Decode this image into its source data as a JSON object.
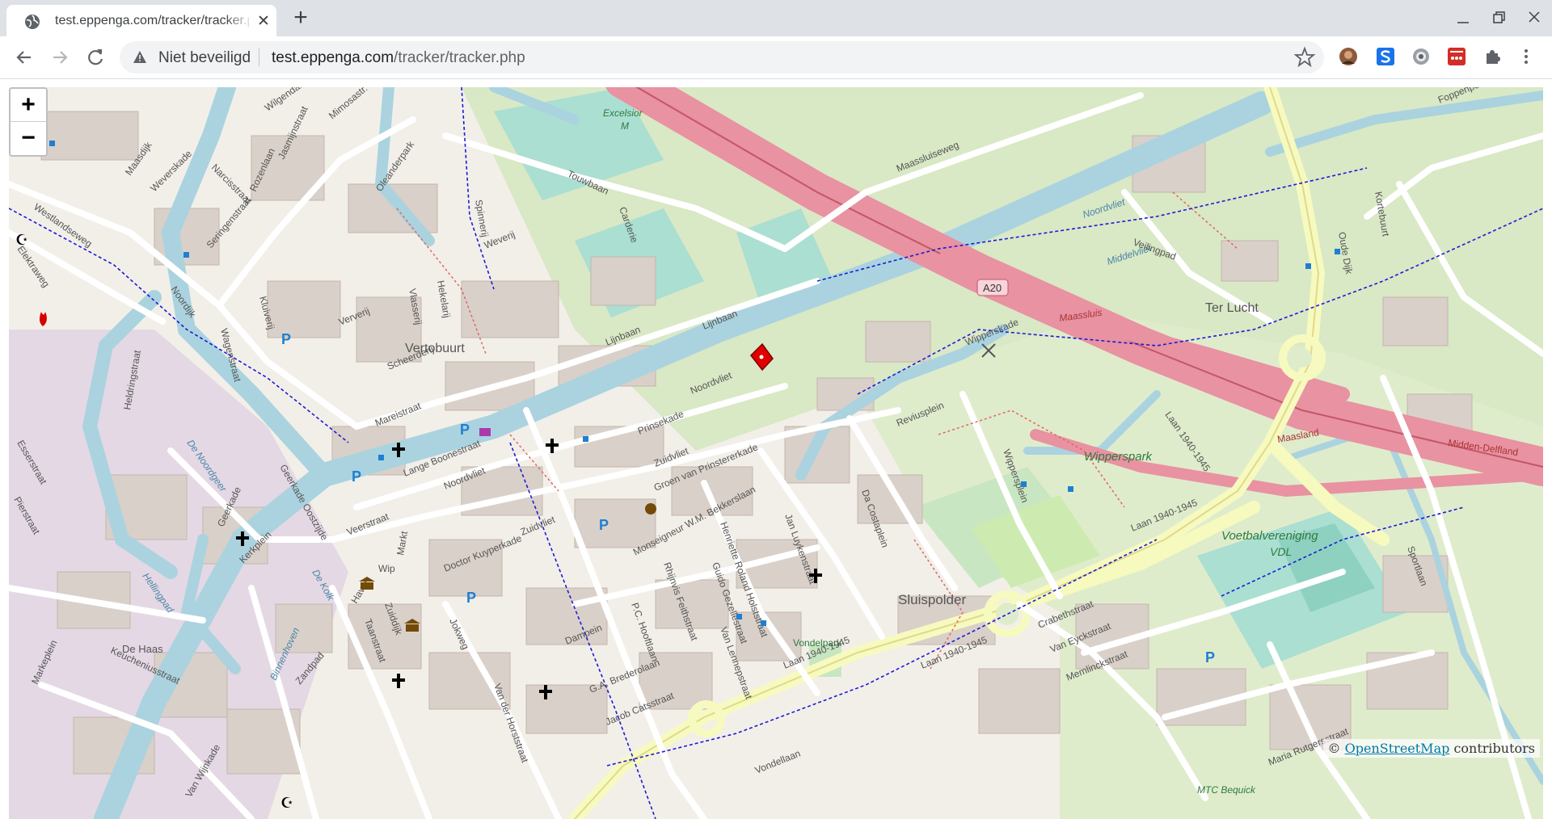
{
  "browser": {
    "tab_title": "test.eppenga.com/tracker/tracker.php",
    "security_label": "Niet beveiligd",
    "url_host": "test.eppenga.com",
    "url_path": "/tracker/tracker.php",
    "icons": [
      "globe-icon",
      "close-icon",
      "plus-icon",
      "minimize-icon",
      "restore-icon",
      "close-window-icon",
      "back-icon",
      "forward-icon",
      "reload-icon",
      "warning-icon",
      "star-icon",
      "puzzle-icon",
      "kebab-menu-icon"
    ]
  },
  "map": {
    "zoom_in": "+",
    "zoom_out": "−",
    "attribution_prefix": "©",
    "attribution_link": "OpenStreetMap",
    "attribution_suffix": "contributors",
    "marker_color": "#e00000",
    "labels": {
      "place_1": "Vertobuurt",
      "place_2": "Ter Lucht",
      "place_3": "Sluispolder",
      "place_4": "Wipperspark",
      "place_5": "Voetbalvereniging",
      "place_6": "VDL",
      "place_7": "De Haas",
      "place_8": "Vondelpark",
      "place_9": "MTC Bequick",
      "place_10": "Excelsior",
      "place_11": "M",
      "water_1": "De Noordgeer",
      "water_2": "Noordvliet",
      "water_3": "Middelvliet",
      "water_4": "De Kolk",
      "water_5": "Binnenhoven",
      "water_6": "Hellingpad",
      "road_a20": "A20",
      "road_maassluis": "Maassluis",
      "road_maasland": "Maasland",
      "road_middendelfland": "Midden-Delfland",
      "street_1": "Noordvliet",
      "street_2": "Prinsekade",
      "street_3": "Zuidvliet",
      "street_4": "Groen van Prinstererkade",
      "street_5": "Wipperskade",
      "street_6": "Laan 1940-1945",
      "street_7": "Laan 1940-1945",
      "street_8": "Lange Boonestraat",
      "street_9": "Doctor Kuyperkade",
      "street_10": "Monseigneur W.M. Bekkerslaan",
      "street_11": "Henriette Roland Holststraat",
      "street_12": "Jan Luykenstraat",
      "street_13": "Da Costaplein",
      "street_14": "Reviusplein",
      "street_15": "Wippersplein",
      "street_16": "Lijnbaan",
      "street_17": "Lijnbaan",
      "street_18": "Weverij",
      "street_19": "Scheerderij",
      "street_20": "Ververij",
      "street_21": "Mareistraat",
      "street_22": "Veerstraat",
      "street_23": "Markt",
      "street_24": "Haven",
      "street_25": "Wip",
      "street_26": "Zuiddijk",
      "street_27": "Noordijk",
      "street_28": "Heldringstraat",
      "street_29": "Esserstraat",
      "street_30": "Pierstraat",
      "street_31": "Westlandseweg",
      "street_32": "Elektraweg",
      "street_33": "Maasdijk",
      "street_34": "Weverskade",
      "street_35": "Narcisstraat",
      "street_36": "Rozenlaan",
      "street_37": "Jasmijnstraat",
      "street_38": "Wilgendal",
      "street_39": "Mimosastr.",
      "street_40": "Oleanderpark",
      "street_41": "Seringenstraat",
      "street_42": "Wagenstraat",
      "street_43": "Kluiverij",
      "street_44": "Touwbaan",
      "street_45": "Spinnerij",
      "street_46": "Carderie",
      "street_47": "Hekelarij",
      "street_48": "Vlasserij",
      "street_49": "Maassluiseweg",
      "street_50": "Foppenpolder",
      "street_51": "Oude Dijk",
      "street_52": "Kortebuurt",
      "street_53": "Veilingpad",
      "street_54": "Sportlaan",
      "street_55": "Crabethstraat",
      "street_56": "Van Eyckstraat",
      "street_57": "Memlinckstraat",
      "street_58": "Maria Rutgersstraat",
      "street_59": "Vondellaan",
      "street_60": "Van Lennepstraat",
      "street_61": "Dampein",
      "street_62": "G.A. Brederolaan",
      "street_63": "Jacob Catsstraat",
      "street_64": "P.C. Hooftlaan",
      "street_65": "Guido Gezellestraat",
      "street_66": "Rhijnvis Feithstraat",
      "street_67": "Jokweg",
      "street_68": "Taanstraat",
      "street_69": "Zandpad",
      "street_70": "Keucheniusstraat",
      "street_71": "Markeplein",
      "street_72": "Geerkade",
      "street_73": "Kerkplein",
      "street_74": "Geerkade Oostzijde",
      "street_75": "Noordvliet",
      "street_76": "Van Wijnkade",
      "street_77": "Zuidvliet",
      "street_78": "Van der Horststraat",
      "street_79": "Laan 1940-1945",
      "street_80": "Laan 1940-1945"
    }
  }
}
